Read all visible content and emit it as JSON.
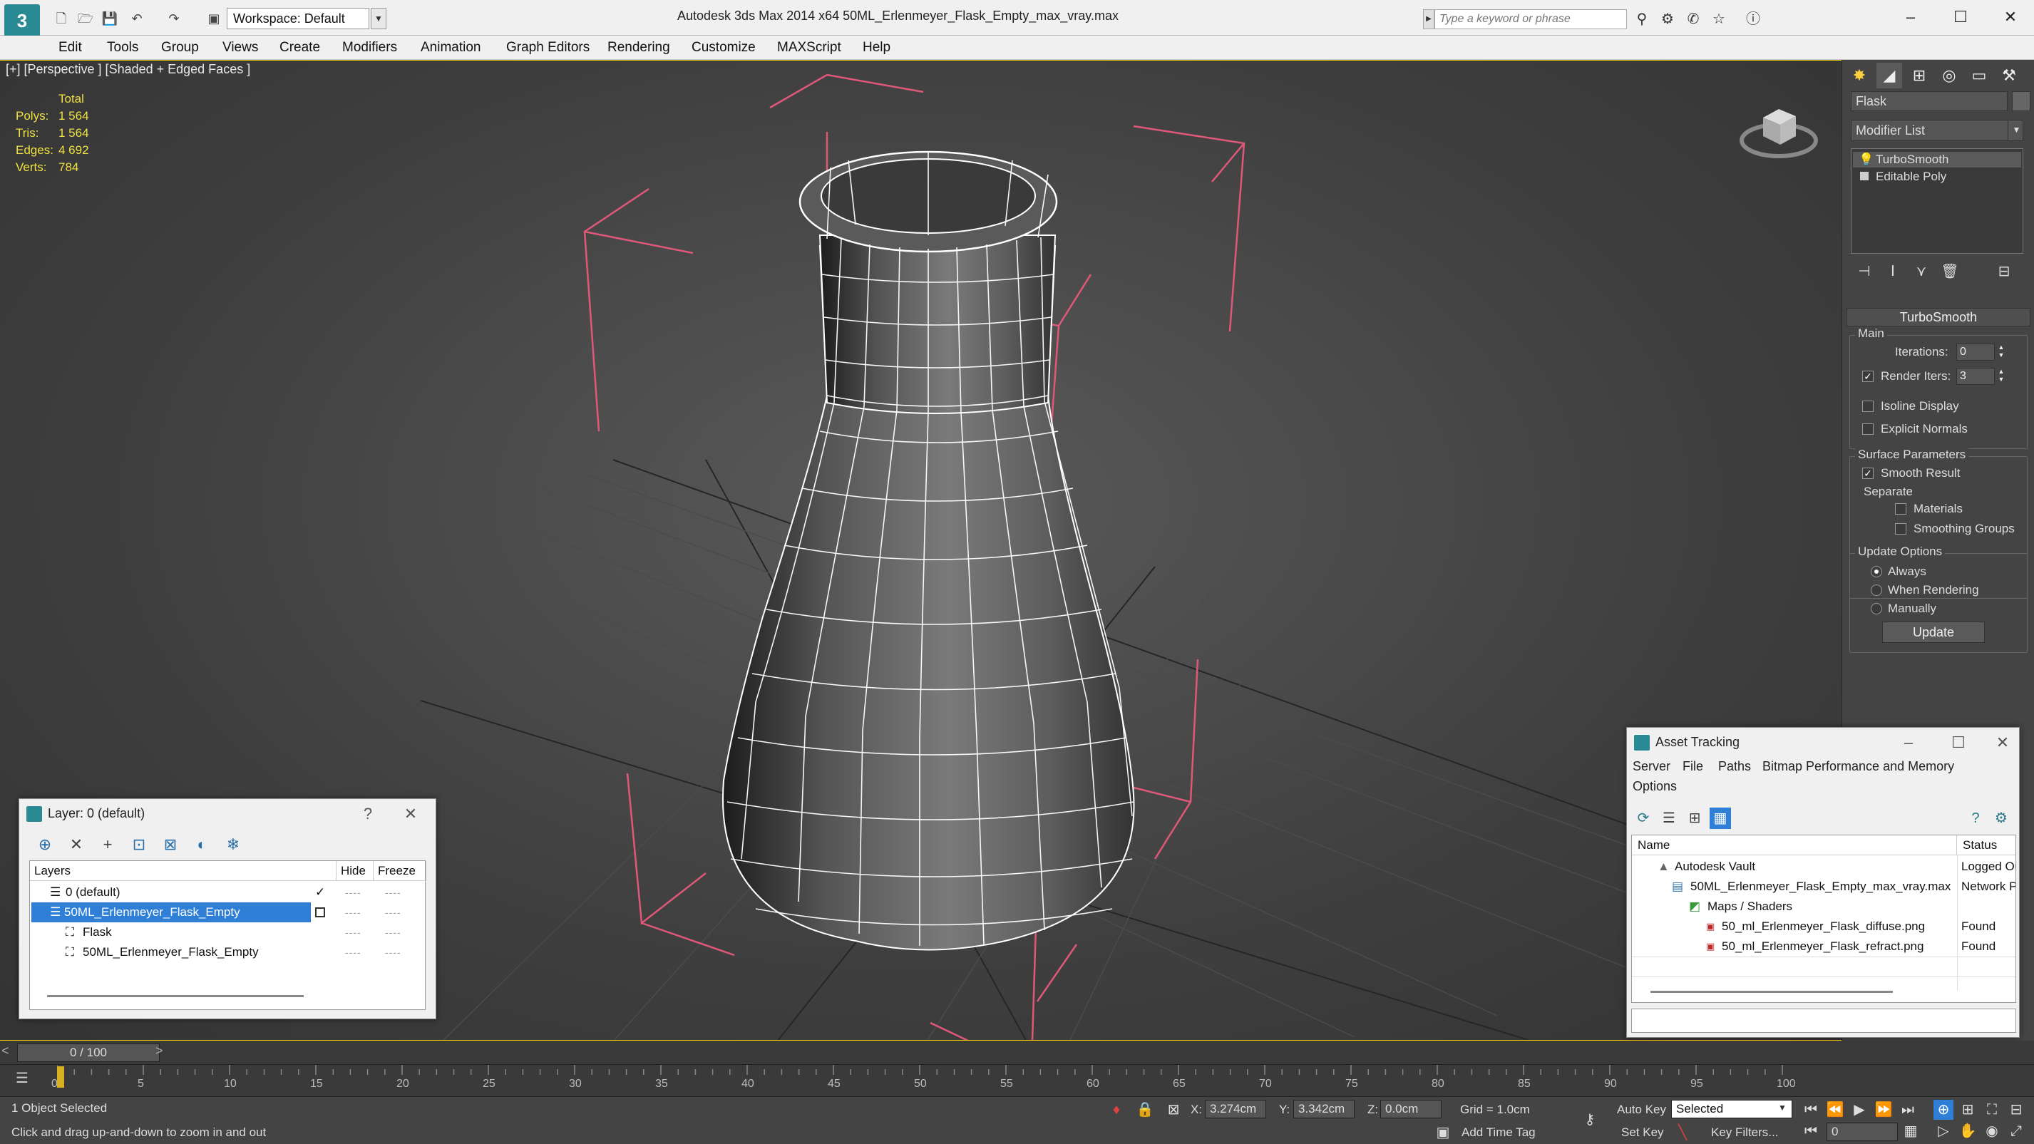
{
  "titlebar": {
    "workspace": "Workspace: Default",
    "title": "Autodesk 3ds Max  2014 x64      50ML_Erlenmeyer_Flask_Empty_max_vray.max",
    "search_placeholder": "Type a keyword or phrase"
  },
  "menu": [
    "Edit",
    "Tools",
    "Group",
    "Views",
    "Create",
    "Modifiers",
    "Animation",
    "Graph Editors",
    "Rendering",
    "Customize",
    "MAXScript",
    "Help"
  ],
  "viewport": {
    "label": "[+] [Perspective ] [Shaded + Edged Faces ]",
    "stats_header": "Total",
    "stats": [
      {
        "label": "Polys:",
        "value": "1 564"
      },
      {
        "label": "Tris:",
        "value": "1 564"
      },
      {
        "label": "Edges:",
        "value": "4 692"
      },
      {
        "label": "Verts:",
        "value": "784"
      }
    ]
  },
  "command_panel": {
    "object_name": "Flask",
    "modifier_list": "Modifier List",
    "stack": [
      "TurboSmooth",
      "Editable Poly"
    ],
    "rollout_title": "TurboSmooth",
    "main_group": "Main",
    "iterations_label": "Iterations:",
    "iterations_value": "0",
    "render_iters_label": "Render Iters:",
    "render_iters_value": "3",
    "isoline_label": "Isoline Display",
    "explicit_normals_label": "Explicit Normals",
    "surface_group": "Surface Parameters",
    "smooth_result_label": "Smooth Result",
    "separate_label": "Separate",
    "materials_label": "Materials",
    "smoothing_groups_label": "Smoothing Groups",
    "update_group": "Update Options",
    "always_label": "Always",
    "when_rendering_label": "When Rendering",
    "manually_label": "Manually",
    "update_button": "Update"
  },
  "layer_dialog": {
    "title": "Layer: 0 (default)",
    "col_layers": "Layers",
    "col_hide": "Hide",
    "col_freeze": "Freeze",
    "rows": [
      {
        "name": "0 (default)",
        "indent": 0
      },
      {
        "name": "50ML_Erlenmeyer_Flask_Empty",
        "indent": 0
      },
      {
        "name": "Flask",
        "indent": 1
      },
      {
        "name": "50ML_Erlenmeyer_Flask_Empty",
        "indent": 1
      }
    ],
    "help_glyph": "?",
    "dash": "----"
  },
  "asset_dialog": {
    "title": "Asset Tracking",
    "menu": [
      "Server",
      "File",
      "Paths",
      "Bitmap Performance and Memory"
    ],
    "menu2": "Options",
    "col_name": "Name",
    "col_status": "Status",
    "rows": [
      {
        "name": "Autodesk Vault",
        "status": "Logged Ou"
      },
      {
        "name": "50ML_Erlenmeyer_Flask_Empty_max_vray.max",
        "status": "Network P"
      },
      {
        "name": "Maps / Shaders",
        "status": ""
      },
      {
        "name": "50_ml_Erlenmeyer_Flask_diffuse.png",
        "status": "Found"
      },
      {
        "name": "50_ml_Erlenmeyer_Flask_refract.png",
        "status": "Found"
      }
    ]
  },
  "timeline": {
    "frame": "0 / 100",
    "ticks": [
      "0",
      "5",
      "10",
      "15",
      "20",
      "25",
      "30",
      "35",
      "40",
      "45",
      "50",
      "55",
      "60",
      "65",
      "70",
      "75",
      "80",
      "85",
      "90",
      "95",
      "100"
    ]
  },
  "status": {
    "selected": "1 Object Selected",
    "prompt": "Click and drag up-and-down to zoom in and out",
    "x_label": "X:",
    "x_value": "3.274cm",
    "y_label": "Y:",
    "y_value": "3.342cm",
    "z_label": "Z:",
    "z_value": "0.0cm",
    "grid": "Grid = 1.0cm",
    "add_time_tag": "Add Time Tag",
    "auto_key": "Auto Key",
    "set_key": "Set Key",
    "selected_dropdown": "Selected",
    "key_filters": "Key Filters...",
    "frame_field": "0"
  }
}
